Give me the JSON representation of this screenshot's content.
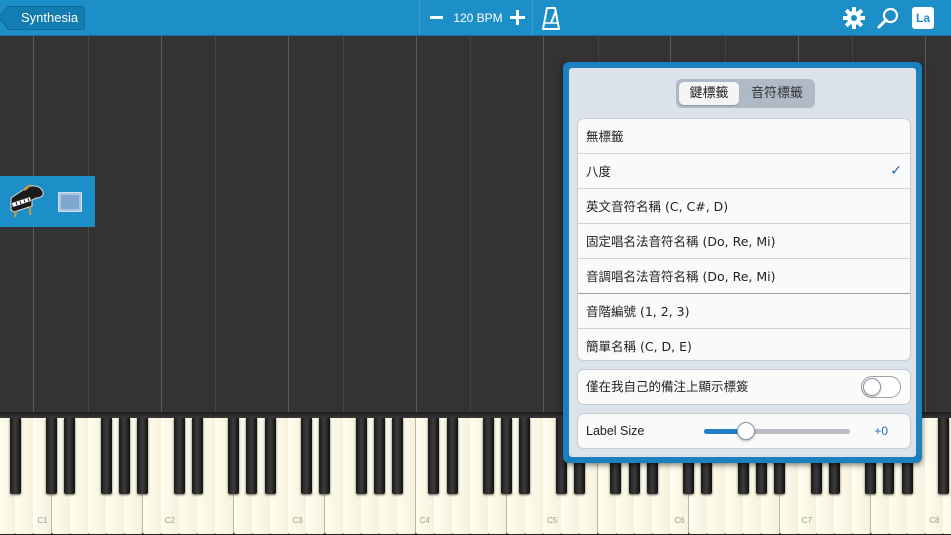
{
  "header": {
    "back_label": "Synthesia",
    "tempo_label": "120 BPM",
    "labels_button": "La"
  },
  "icons": {
    "back": "chevron-left-icon",
    "tempo_down": "minus-icon",
    "tempo_up": "plus-icon",
    "metronome": "metronome-icon",
    "settings": "gear-icon",
    "search": "magnifier-icon",
    "instrument": "grand-piano-icon",
    "display": "screen-icon"
  },
  "colors": {
    "accent": "#1c8fc9",
    "popover_border": "#1a80bf",
    "check": "#2862a8",
    "slider_fill": "#1f7fc9"
  },
  "popover": {
    "tabs": [
      {
        "label": "鍵標籤",
        "active": true
      },
      {
        "label": "音符標籤",
        "active": false
      }
    ],
    "options": [
      {
        "label": "無標籤",
        "selected": false
      },
      {
        "label": "八度",
        "selected": true
      },
      {
        "label": "英文音符名稱 (C, C#, D)",
        "selected": false
      },
      {
        "label": "固定唱名法音符名稱 (Do, Re, Mi)",
        "selected": false
      },
      {
        "label": "音調唱名法音符名稱 (Do, Re, Mi)",
        "selected": false
      },
      {
        "label": "音階編號 (1, 2, 3)",
        "selected": false
      },
      {
        "label": "簡單名稱 (C, D, E)",
        "selected": false
      }
    ],
    "check_mark": "✓",
    "own_notes_toggle": {
      "label": "僅在我自己的備注上顯示標簽",
      "on": false
    },
    "label_size": {
      "label": "Label Size",
      "value_text": "+0",
      "position_fraction": 0.29
    }
  },
  "keyboard": {
    "octave_labels": [
      "C1",
      "C2",
      "C3",
      "C4",
      "C5",
      "C6",
      "C7",
      "C8"
    ]
  }
}
